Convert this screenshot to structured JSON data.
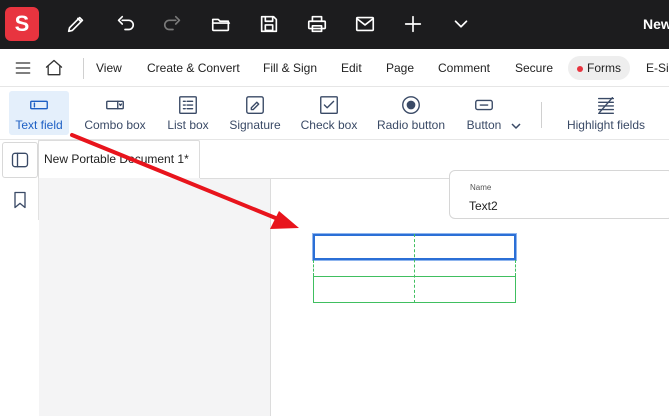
{
  "titlebar": {
    "logo_letter": "S",
    "doc_title": "New",
    "icons": [
      "pen-icon",
      "undo-icon",
      "redo-icon",
      "open-folder-icon",
      "save-icon",
      "print-icon",
      "mail-icon",
      "plus-icon",
      "chevron-down-icon"
    ]
  },
  "menubar": {
    "items": [
      "View",
      "Create & Convert",
      "Fill & Sign",
      "Edit",
      "Page",
      "Comment",
      "Secure",
      "Forms",
      "E-Sig"
    ],
    "active": "Forms"
  },
  "ribbon": {
    "tools": [
      {
        "label": "Text field",
        "icon": "text-field-icon",
        "active": true
      },
      {
        "label": "Combo box",
        "icon": "combo-box-icon"
      },
      {
        "label": "List box",
        "icon": "list-box-icon"
      },
      {
        "label": "Signature",
        "icon": "signature-icon"
      },
      {
        "label": "Check box",
        "icon": "check-box-icon"
      },
      {
        "label": "Radio button",
        "icon": "radio-button-icon"
      },
      {
        "label": "Button",
        "icon": "button-icon"
      },
      {
        "label": "Highlight fields",
        "icon": "highlight-fields-icon"
      }
    ]
  },
  "tab": {
    "label": "New Portable Document 1*"
  },
  "properties": {
    "name_caption": "Name",
    "name_value": "Text2"
  },
  "colors": {
    "titlebar": "#1c1c1e",
    "brand": "#e8343f",
    "active_tool": "#1d5fc4",
    "selection": "#2b6fd6",
    "guide": "#40bf60",
    "annotation_arrow": "#e8141c"
  }
}
